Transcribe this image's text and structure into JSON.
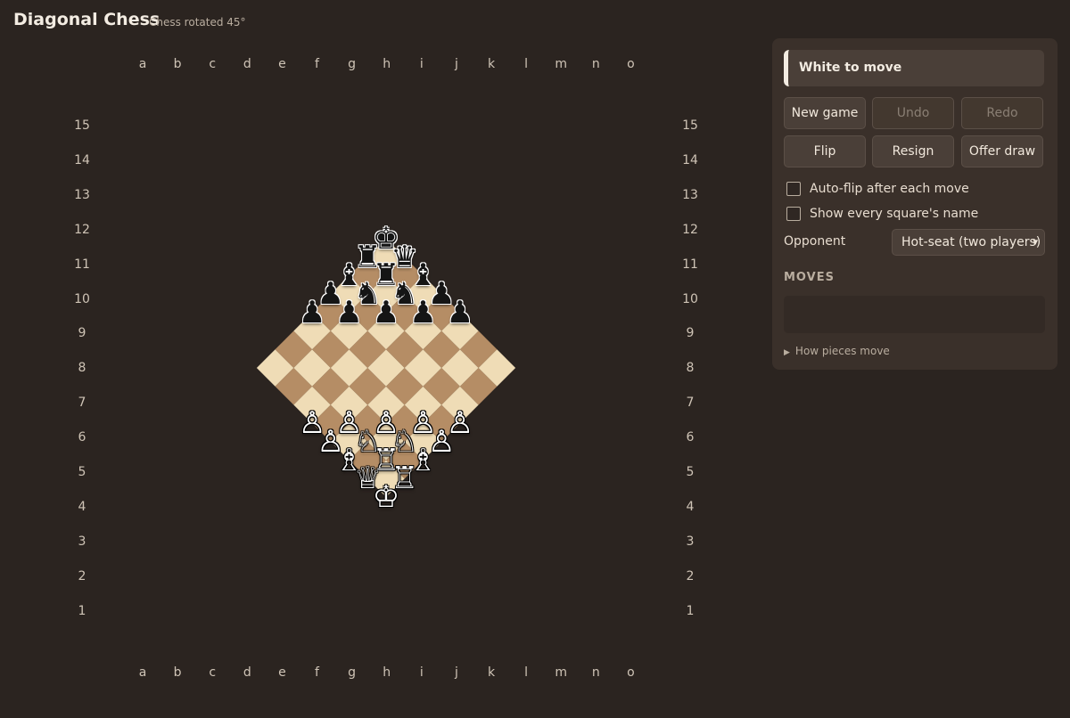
{
  "header": {
    "title": "Diagonal Chess",
    "subtitle": "Chess rotated 45°"
  },
  "board": {
    "files": [
      "a",
      "b",
      "c",
      "d",
      "e",
      "f",
      "g",
      "h",
      "i",
      "j",
      "k",
      "l",
      "m",
      "n",
      "o"
    ],
    "ranks": [
      "15",
      "14",
      "13",
      "12",
      "11",
      "10",
      "9",
      "8",
      "7",
      "6",
      "5",
      "4",
      "3",
      "2",
      "1"
    ],
    "colors": {
      "light": "#efdcb6",
      "dark": "#b58d65"
    },
    "pieces": [
      {
        "square": "h15",
        "type": "king",
        "color": "black",
        "glyph": "♚"
      },
      {
        "square": "g14",
        "type": "rook",
        "color": "black",
        "glyph": "♜"
      },
      {
        "square": "i14",
        "type": "queen",
        "color": "black",
        "glyph": "♛"
      },
      {
        "square": "f13",
        "type": "bishop",
        "color": "black",
        "glyph": "♝"
      },
      {
        "square": "h13",
        "type": "rook",
        "color": "black",
        "glyph": "♜"
      },
      {
        "square": "j13",
        "type": "bishop",
        "color": "black",
        "glyph": "♝"
      },
      {
        "square": "e12",
        "type": "pawn",
        "color": "black",
        "glyph": "♟"
      },
      {
        "square": "g12",
        "type": "knight",
        "color": "black",
        "glyph": "♞"
      },
      {
        "square": "i12",
        "type": "knight",
        "color": "black",
        "glyph": "♞"
      },
      {
        "square": "k12",
        "type": "pawn",
        "color": "black",
        "glyph": "♟"
      },
      {
        "square": "d11",
        "type": "pawn",
        "color": "black",
        "glyph": "♟"
      },
      {
        "square": "f11",
        "type": "pawn",
        "color": "black",
        "glyph": "♟"
      },
      {
        "square": "h11",
        "type": "pawn",
        "color": "black",
        "glyph": "♟"
      },
      {
        "square": "j11",
        "type": "pawn",
        "color": "black",
        "glyph": "♟"
      },
      {
        "square": "l11",
        "type": "pawn",
        "color": "black",
        "glyph": "♟"
      },
      {
        "square": "d5",
        "type": "pawn",
        "color": "white",
        "glyph": "♙"
      },
      {
        "square": "f5",
        "type": "pawn",
        "color": "white",
        "glyph": "♙"
      },
      {
        "square": "h5",
        "type": "pawn",
        "color": "white",
        "glyph": "♙"
      },
      {
        "square": "j5",
        "type": "pawn",
        "color": "white",
        "glyph": "♙"
      },
      {
        "square": "l5",
        "type": "pawn",
        "color": "white",
        "glyph": "♙"
      },
      {
        "square": "e4",
        "type": "pawn",
        "color": "white",
        "glyph": "♙"
      },
      {
        "square": "g4",
        "type": "knight",
        "color": "white",
        "glyph": "♘"
      },
      {
        "square": "i4",
        "type": "knight",
        "color": "white",
        "glyph": "♘"
      },
      {
        "square": "k4",
        "type": "pawn",
        "color": "white",
        "glyph": "♙"
      },
      {
        "square": "f3",
        "type": "bishop",
        "color": "white",
        "glyph": "♗"
      },
      {
        "square": "h3",
        "type": "rook",
        "color": "white",
        "glyph": "♖"
      },
      {
        "square": "j3",
        "type": "bishop",
        "color": "white",
        "glyph": "♗"
      },
      {
        "square": "g2",
        "type": "queen",
        "color": "white",
        "glyph": "♕"
      },
      {
        "square": "i2",
        "type": "rook",
        "color": "white",
        "glyph": "♖"
      },
      {
        "square": "h1",
        "type": "king",
        "color": "white",
        "glyph": "♔"
      }
    ]
  },
  "panel": {
    "status": "White to move",
    "buttons": {
      "new_game": "New game",
      "undo": "Undo",
      "redo": "Redo",
      "flip": "Flip",
      "resign": "Resign",
      "offer_draw": "Offer draw"
    },
    "checkboxes": {
      "auto_flip": {
        "label": "Auto-flip after each move",
        "checked": false
      },
      "show_names": {
        "label": "Show every square's name",
        "checked": false
      }
    },
    "opponent": {
      "label": "Opponent",
      "selected": "Hot-seat (two players)"
    },
    "moves": {
      "heading": "MOVES"
    },
    "how_pieces_move": "How pieces move"
  }
}
